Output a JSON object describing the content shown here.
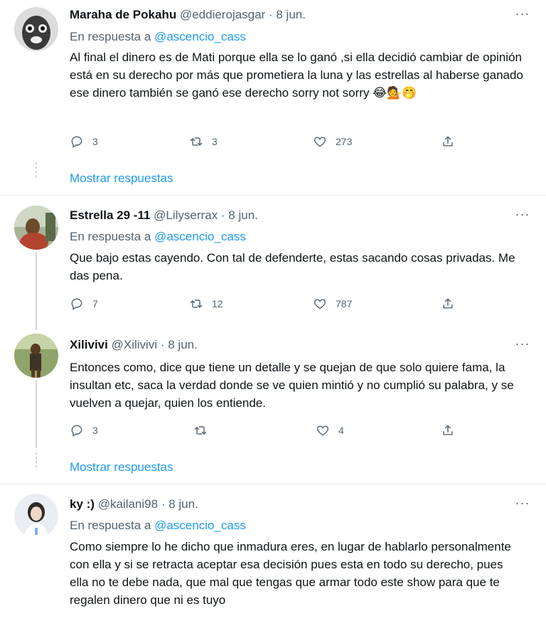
{
  "tweets": [
    {
      "name": "Maraha de Pokahu",
      "handle": "@eddierojasgar",
      "dot": "·",
      "date": "8 jun.",
      "reply_prefix": "En respuesta a",
      "reply_to": "@ascencio_cass",
      "text": "Al final el dinero es de Mati porque ella se lo ganó ,si ella decidió cambiar de opinión está en su derecho por más que prometiera la luna y las estrellas al haberse ganado ese dinero también se ganó ese derecho sorry not sorry 😂💁🤭",
      "replies": "3",
      "retweets": "3",
      "likes": "273"
    },
    {
      "name": "Estrella 29 -11",
      "handle": "@Lilyserrax",
      "dot": "·",
      "date": "8 jun.",
      "reply_prefix": "En respuesta a",
      "reply_to": "@ascencio_cass",
      "text": "Que bajo estas cayendo. Con tal de defenderte, estas sacando cosas privadas. Me das pena.",
      "replies": "7",
      "retweets": "12",
      "likes": "787"
    },
    {
      "name": "Xilivivi",
      "handle": "@Xilivivi",
      "dot": "·",
      "date": "8 jun.",
      "text": "Entonces como, dice que tiene un detalle y se quejan de que solo quiere fama, la insultan etc, saca la verdad donde se ve quien mintió y no cumplió su palabra, y se vuelven a quejar, quien los entiende.",
      "replies": "3",
      "retweets": "",
      "likes": "4"
    },
    {
      "name": "ky :)",
      "handle": "@kailani98",
      "dot": "·",
      "date": "8 jun.",
      "reply_prefix": "En respuesta a",
      "reply_to": "@ascencio_cass",
      "text": "Como siempre lo he dicho que inmadura eres, en lugar de hablarlo personalmente con ella y si se retracta aceptar esa decisión pues esta en todo su derecho, pues ella no te debe nada, que mal que tengas que armar todo este show para que te regalen dinero que ni es tuyo"
    }
  ],
  "show_replies_label": "Mostrar respuestas",
  "more_label": "···",
  "icons": [
    "reply-icon",
    "retweet-icon",
    "like-icon",
    "share-icon",
    "more-icon"
  ],
  "colors": {
    "link": "#1d9bf0",
    "muted": "#536471",
    "text": "#0f1419",
    "line": "#cfd9de"
  }
}
